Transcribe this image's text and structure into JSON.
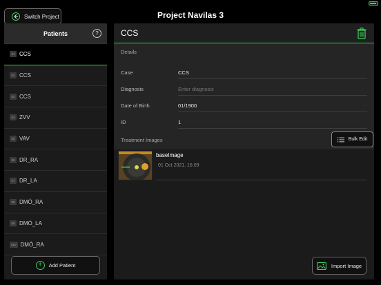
{
  "app": {
    "title": "Project Navilas 3"
  },
  "toolbar": {
    "switch_project_label": "Switch Project"
  },
  "sidebar": {
    "title": "Patients",
    "add_patient_label": "Add Patient",
    "items": [
      {
        "num": "01",
        "name": "CCS",
        "selected": true
      },
      {
        "num": "02",
        "name": "CCS"
      },
      {
        "num": "03",
        "name": "CCS"
      },
      {
        "num": "04",
        "name": "ZVV"
      },
      {
        "num": "05",
        "name": "VAV"
      },
      {
        "num": "06",
        "name": "DR_RA"
      },
      {
        "num": "07",
        "name": "DR_LA"
      },
      {
        "num": "08",
        "name": "DMÓ_RA"
      },
      {
        "num": "09",
        "name": "DMÓ_LA"
      },
      {
        "num": "010",
        "name": "DMÓ_RA"
      }
    ]
  },
  "detail": {
    "title": "CCS",
    "details_label": "Details",
    "fields": {
      "case": {
        "label": "Case",
        "value": "CCS"
      },
      "diagnosis": {
        "label": "Diagnosis",
        "placeholder": "Enter diagnosis"
      },
      "dob": {
        "label": "Date of Birth",
        "value": "01/1900"
      },
      "id": {
        "label": "ID",
        "value": "1"
      }
    },
    "treatment_label": "Treatment Images",
    "bulk_edit_label": "Bulk Edit",
    "images": [
      {
        "name": "baseImage",
        "date": "01 Oct 2021, 16:09"
      }
    ],
    "import_label": "Import Image"
  },
  "colors": {
    "accent": "#3ecf5a",
    "background": "#000000",
    "panel": "#1b1b1b"
  }
}
